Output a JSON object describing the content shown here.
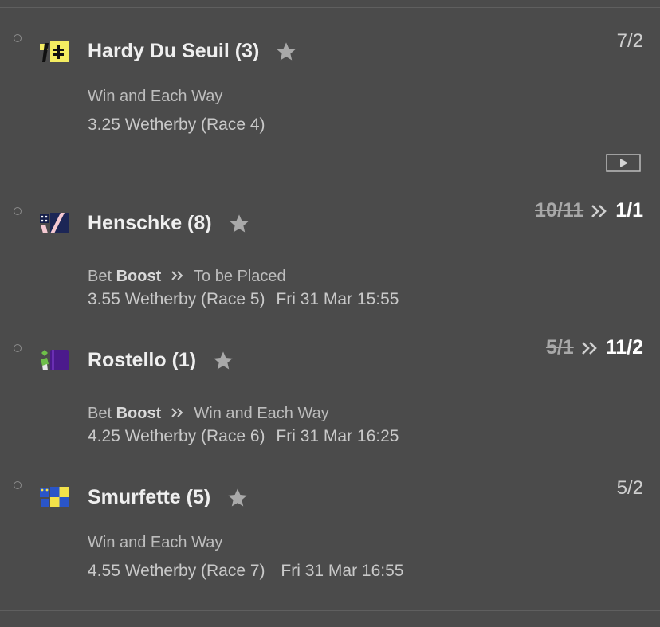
{
  "selections": [
    {
      "name": "Hardy Du Seuil (3)",
      "odds": "7/2",
      "market": "Win and Each Way",
      "event": "3.25 Wetherby (Race 4)"
    },
    {
      "name": "Henschke (8)",
      "old_odds": "10/11",
      "new_odds": "1/1",
      "boost_prefix": "Bet",
      "boost_word": "Boost",
      "market": "To be Placed",
      "event": "3.55 Wetherby (Race 5)",
      "time": "Fri 31 Mar 15:55"
    },
    {
      "name": "Rostello (1)",
      "old_odds": "5/1",
      "new_odds": "11/2",
      "boost_prefix": "Bet",
      "boost_word": "Boost",
      "market": "Win and Each Way",
      "event": "4.25 Wetherby (Race 6)",
      "time": "Fri 31 Mar 16:25"
    },
    {
      "name": "Smurfette (5)",
      "odds": "5/2",
      "market": "Win and Each Way",
      "event": "4.55 Wetherby (Race 7)",
      "time": "Fri 31 Mar 16:55"
    }
  ],
  "icons": {
    "favourite": "star-icon",
    "video": "play-video-icon",
    "boost": "double-chevron-icon",
    "selector": "radio-circle-icon"
  },
  "colors": {
    "background": "#4b4b4b",
    "star": "#a9a9a9",
    "boosted_odds": "#ffffff"
  }
}
